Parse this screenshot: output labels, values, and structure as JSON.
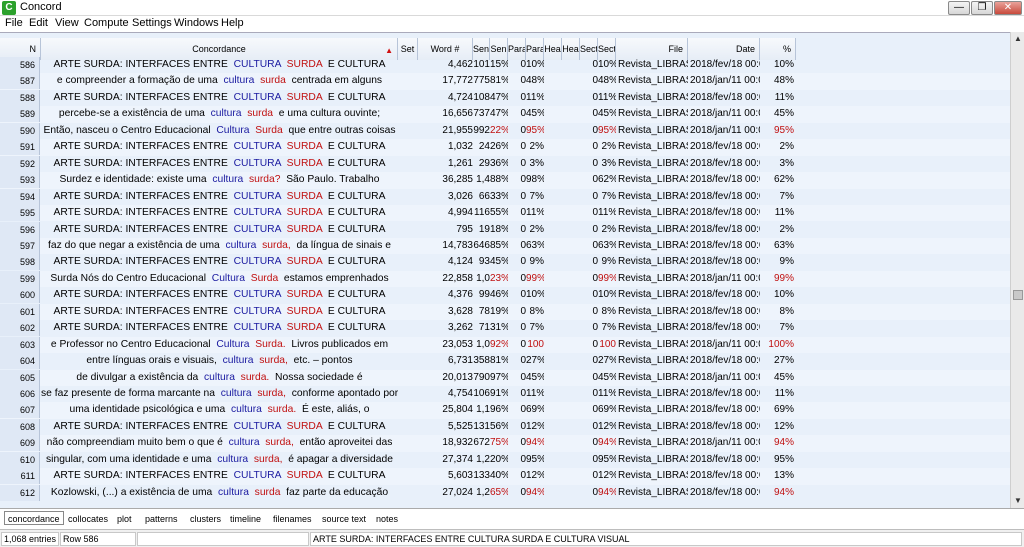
{
  "window": {
    "title": "Concord",
    "icon_letter": "C"
  },
  "menu": [
    "File",
    "Edit",
    "View",
    "Compute",
    "Settings",
    "Windows",
    "Help"
  ],
  "columns": [
    "N",
    "Concordance",
    "Set",
    "Word #",
    "Sen",
    "Sen",
    "Para",
    "Para",
    "Hea",
    "Hea",
    "Sect",
    "Sect",
    "File",
    "Date",
    "%"
  ],
  "rows": [
    {
      "n": "586",
      "left": "ARTE SURDA: INTERFACES ENTRE",
      "k1": "CULTURA",
      "k2": "SURDA",
      "right": "E CULTURA",
      "word": "4,462",
      "s1": "101",
      "s2": "15%",
      "p1": "0",
      "p2": "10%",
      "sc1": "0",
      "sc2": "10%",
      "file": "Revista_LIBRAS",
      "date": "2018/fev/18 00:0",
      "pct": "10%",
      "red": false
    },
    {
      "n": "587",
      "left": "e compreender a formação de uma",
      "k1": "cultura",
      "k2": "surda",
      "right": "centrada em alguns",
      "word": "17,772",
      "s1": "775",
      "s2": "81%",
      "p1": "0",
      "p2": "48%",
      "sc1": "0",
      "sc2": "48%",
      "file": "Revista_LIBRAS",
      "date": "2018/jan/11 00:0",
      "pct": "48%",
      "red": false
    },
    {
      "n": "588",
      "left": "ARTE SURDA: INTERFACES ENTRE",
      "k1": "CULTURA",
      "k2": "SURDA",
      "right": "E CULTURA",
      "word": "4,724",
      "s1": "108",
      "s2": "47%",
      "p1": "0",
      "p2": "11%",
      "sc1": "0",
      "sc2": "11%",
      "file": "Revista_LIBRAS",
      "date": "2018/fev/18 00:0",
      "pct": "11%",
      "red": false
    },
    {
      "n": "589",
      "left": "percebe-se a existência de uma",
      "k1": "cultura",
      "k2": "surda",
      "right": "e uma cultura ouvinte;",
      "word": "16,656",
      "s1": "737",
      "s2": "47%",
      "p1": "0",
      "p2": "45%",
      "sc1": "0",
      "sc2": "45%",
      "file": "Revista_LIBRAS",
      "date": "2018/jan/11 00:0",
      "pct": "45%",
      "red": false
    },
    {
      "n": "590",
      "left": "Então, nasceu o Centro Educacional",
      "k1": "Cultura",
      "k2": "Surda",
      "right": "que entre outras coisas",
      "word": "21,955",
      "s1": "992",
      "s2": "22%",
      "p1": "0",
      "p2": "95%",
      "sc1": "0",
      "sc2": "95%",
      "file": "Revista_LIBRAS",
      "date": "2018/jan/11 00:0",
      "pct": "95%",
      "red": true
    },
    {
      "n": "591",
      "left": "ARTE SURDA: INTERFACES ENTRE",
      "k1": "CULTURA",
      "k2": "SURDA",
      "right": "E CULTURA",
      "word": "1,032",
      "s1": "24",
      "s2": "26%",
      "p1": "0",
      "p2": "2%",
      "sc1": "0",
      "sc2": "2%",
      "file": "Revista_LIBRAS",
      "date": "2018/fev/18 00:0",
      "pct": "2%",
      "red": false
    },
    {
      "n": "592",
      "left": "ARTE SURDA: INTERFACES ENTRE",
      "k1": "CULTURA",
      "k2": "SURDA",
      "right": "E CULTURA",
      "word": "1,261",
      "s1": "29",
      "s2": "36%",
      "p1": "0",
      "p2": "3%",
      "sc1": "0",
      "sc2": "3%",
      "file": "Revista_LIBRAS",
      "date": "2018/fev/18 00:0",
      "pct": "3%",
      "red": false
    },
    {
      "n": "593",
      "left": "Surdez e identidade: existe uma",
      "k1": "cultura",
      "k2": "surda?",
      "right": "São Paulo. Trabalho",
      "word": "36,285",
      "s1": "1,4",
      "s2": "88%",
      "p1": "0",
      "p2": "98%",
      "sc1": "0",
      "sc2": "62%",
      "file": "Revista_LIBRAS",
      "date": "2018/fev/18 00:0",
      "pct": "62%",
      "red": false
    },
    {
      "n": "594",
      "left": "ARTE SURDA: INTERFACES ENTRE",
      "k1": "CULTURA",
      "k2": "SURDA",
      "right": "E CULTURA",
      "word": "3,026",
      "s1": "66",
      "s2": "33%",
      "p1": "0",
      "p2": "7%",
      "sc1": "0",
      "sc2": "7%",
      "file": "Revista_LIBRAS",
      "date": "2018/fev/18 00:0",
      "pct": "7%",
      "red": false
    },
    {
      "n": "595",
      "left": "ARTE SURDA: INTERFACES ENTRE",
      "k1": "CULTURA",
      "k2": "SURDA",
      "right": "E CULTURA",
      "word": "4,994",
      "s1": "116",
      "s2": "55%",
      "p1": "0",
      "p2": "11%",
      "sc1": "0",
      "sc2": "11%",
      "file": "Revista_LIBRAS",
      "date": "2018/fev/18 00:0",
      "pct": "11%",
      "red": false
    },
    {
      "n": "596",
      "left": "ARTE SURDA: INTERFACES ENTRE",
      "k1": "CULTURA",
      "k2": "SURDA",
      "right": "E CULTURA",
      "word": "795",
      "s1": "19",
      "s2": "18%",
      "p1": "0",
      "p2": "2%",
      "sc1": "0",
      "sc2": "2%",
      "file": "Revista_LIBRAS",
      "date": "2018/fev/18 00:0",
      "pct": "2%",
      "red": false
    },
    {
      "n": "597",
      "left": "faz do que negar a existência de uma",
      "k1": "cultura",
      "k2": "surda,",
      "right": "da língua de sinais e",
      "word": "14,783",
      "s1": "646",
      "s2": "85%",
      "p1": "0",
      "p2": "63%",
      "sc1": "0",
      "sc2": "63%",
      "file": "Revista_LIBRAS",
      "date": "2018/fev/18 00:0",
      "pct": "63%",
      "red": false
    },
    {
      "n": "598",
      "left": "ARTE SURDA: INTERFACES ENTRE",
      "k1": "CULTURA",
      "k2": "SURDA",
      "right": "E CULTURA",
      "word": "4,124",
      "s1": "93",
      "s2": "45%",
      "p1": "0",
      "p2": "9%",
      "sc1": "0",
      "sc2": "9%",
      "file": "Revista_LIBRAS",
      "date": "2018/fev/18 00:0",
      "pct": "9%",
      "red": false
    },
    {
      "n": "599",
      "left": "Surda Nós do Centro Educacional",
      "k1": "Cultura",
      "k2": "Surda",
      "right": "estamos emprenhados",
      "word": "22,858",
      "s1": "1,0",
      "s2": "23%",
      "p1": "0",
      "p2": "99%",
      "sc1": "0",
      "sc2": "99%",
      "file": "Revista_LIBRAS",
      "date": "2018/jan/11 00:0",
      "pct": "99%",
      "red": true
    },
    {
      "n": "600",
      "left": "ARTE SURDA: INTERFACES ENTRE",
      "k1": "CULTURA",
      "k2": "SURDA",
      "right": "E CULTURA",
      "word": "4,376",
      "s1": "99",
      "s2": "46%",
      "p1": "0",
      "p2": "10%",
      "sc1": "0",
      "sc2": "10%",
      "file": "Revista_LIBRAS",
      "date": "2018/fev/18 00:0",
      "pct": "10%",
      "red": false
    },
    {
      "n": "601",
      "left": "ARTE SURDA: INTERFACES ENTRE",
      "k1": "CULTURA",
      "k2": "SURDA",
      "right": "E CULTURA",
      "word": "3,628",
      "s1": "78",
      "s2": "19%",
      "p1": "0",
      "p2": "8%",
      "sc1": "0",
      "sc2": "8%",
      "file": "Revista_LIBRAS",
      "date": "2018/fev/18 00:0",
      "pct": "8%",
      "red": false
    },
    {
      "n": "602",
      "left": "ARTE SURDA: INTERFACES ENTRE",
      "k1": "CULTURA",
      "k2": "SURDA",
      "right": "E CULTURA",
      "word": "3,262",
      "s1": "71",
      "s2": "31%",
      "p1": "0",
      "p2": "7%",
      "sc1": "0",
      "sc2": "7%",
      "file": "Revista_LIBRAS",
      "date": "2018/fev/18 00:0",
      "pct": "7%",
      "red": false
    },
    {
      "n": "603",
      "left": "e Professor no Centro Educacional",
      "k1": "Cultura",
      "k2": "Surda.",
      "right": "Livros publicados em",
      "word": "23,053",
      "s1": "1,0",
      "s2": "92%",
      "p1": "0",
      "p2": "100",
      "sc1": "0",
      "sc2": "100",
      "file": "Revista_LIBRAS",
      "date": "2018/jan/11 00:0",
      "pct": "100%",
      "red": true
    },
    {
      "n": "604",
      "left": "entre línguas orais e visuais,",
      "k1": "cultura",
      "k2": "surda,",
      "right": "etc. – pontos",
      "word": "6,731",
      "s1": "358",
      "s2": "81%",
      "p1": "0",
      "p2": "27%",
      "sc1": "0",
      "sc2": "27%",
      "file": "Revista_LIBRAS",
      "date": "2018/fev/18 00:0",
      "pct": "27%",
      "red": false
    },
    {
      "n": "605",
      "left": "de divulgar a existência da",
      "k1": "cultura",
      "k2": "surda.",
      "right": "Nossa sociedade é",
      "word": "20,013",
      "s1": "790",
      "s2": "97%",
      "p1": "0",
      "p2": "45%",
      "sc1": "0",
      "sc2": "45%",
      "file": "Revista_LIBRAS",
      "date": "2018/jan/11 00:0",
      "pct": "45%",
      "red": false
    },
    {
      "n": "606",
      "left": "se faz presente de forma marcante na",
      "k1": "cultura",
      "k2": "surda,",
      "right": "conforme apontado por",
      "word": "4,754",
      "s1": "106",
      "s2": "91%",
      "p1": "0",
      "p2": "11%",
      "sc1": "0",
      "sc2": "11%",
      "file": "Revista_LIBRAS",
      "date": "2018/fev/18 00:0",
      "pct": "11%",
      "red": false
    },
    {
      "n": "607",
      "left": "uma identidade psicológica e uma",
      "k1": "cultura",
      "k2": "surda.",
      "right": "É este, aliás, o",
      "word": "25,804",
      "s1": "1,1",
      "s2": "96%",
      "p1": "0",
      "p2": "69%",
      "sc1": "0",
      "sc2": "69%",
      "file": "Revista_LIBRAS",
      "date": "2018/fev/18 00:0",
      "pct": "69%",
      "red": false
    },
    {
      "n": "608",
      "left": "ARTE SURDA: INTERFACES ENTRE",
      "k1": "CULTURA",
      "k2": "SURDA",
      "right": "E CULTURA",
      "word": "5,525",
      "s1": "131",
      "s2": "56%",
      "p1": "0",
      "p2": "12%",
      "sc1": "0",
      "sc2": "12%",
      "file": "Revista_LIBRAS",
      "date": "2018/fev/18 00:0",
      "pct": "12%",
      "red": false
    },
    {
      "n": "609",
      "left": "não compreendiam muito bem o que é",
      "k1": "cultura",
      "k2": "surda,",
      "right": "então aproveitei das",
      "word": "18,932",
      "s1": "672",
      "s2": "75%",
      "p1": "0",
      "p2": "94%",
      "sc1": "0",
      "sc2": "94%",
      "file": "Revista_LIBRAS",
      "date": "2018/jan/11 00:0",
      "pct": "94%",
      "red": true
    },
    {
      "n": "610",
      "left": "singular, com uma identidade e uma",
      "k1": "cultura",
      "k2": "surda,",
      "right": "é apagar a diversidade",
      "word": "27,374",
      "s1": "1,2",
      "s2": "20%",
      "p1": "0",
      "p2": "95%",
      "sc1": "0",
      "sc2": "95%",
      "file": "Revista_LIBRAS",
      "date": "2018/fev/18 00:0",
      "pct": "95%",
      "red": false
    },
    {
      "n": "611",
      "left": "ARTE SURDA: INTERFACES ENTRE",
      "k1": "CULTURA",
      "k2": "SURDA",
      "right": "E CULTURA",
      "word": "5,603",
      "s1": "133",
      "s2": "40%",
      "p1": "0",
      "p2": "12%",
      "sc1": "0",
      "sc2": "12%",
      "file": "Revista_LIBRAS",
      "date": "2018/fev/18 00:0",
      "pct": "13%",
      "red": false
    },
    {
      "n": "612",
      "left": "Kozlowski, (...) a existência de uma",
      "k1": "cultura",
      "k2": "surda",
      "right": "faz parte da educação",
      "word": "27,024",
      "s1": "1,2",
      "s2": "65%",
      "p1": "0",
      "p2": "94%",
      "sc1": "0",
      "sc2": "94%",
      "file": "Revista_LIBRAS",
      "date": "2018/fev/18 00:0",
      "pct": "94%",
      "red": true
    }
  ],
  "tabs": [
    "concordance",
    "collocates",
    "plot",
    "patterns",
    "clusters",
    "timeline",
    "filenames",
    "source text",
    "notes"
  ],
  "status": {
    "entries": "1,068 entries",
    "row": "Row 586",
    "selected_text": "ARTE SURDA: INTERFACES ENTRE CULTURA SURDA E CULTURA VISUAL"
  }
}
